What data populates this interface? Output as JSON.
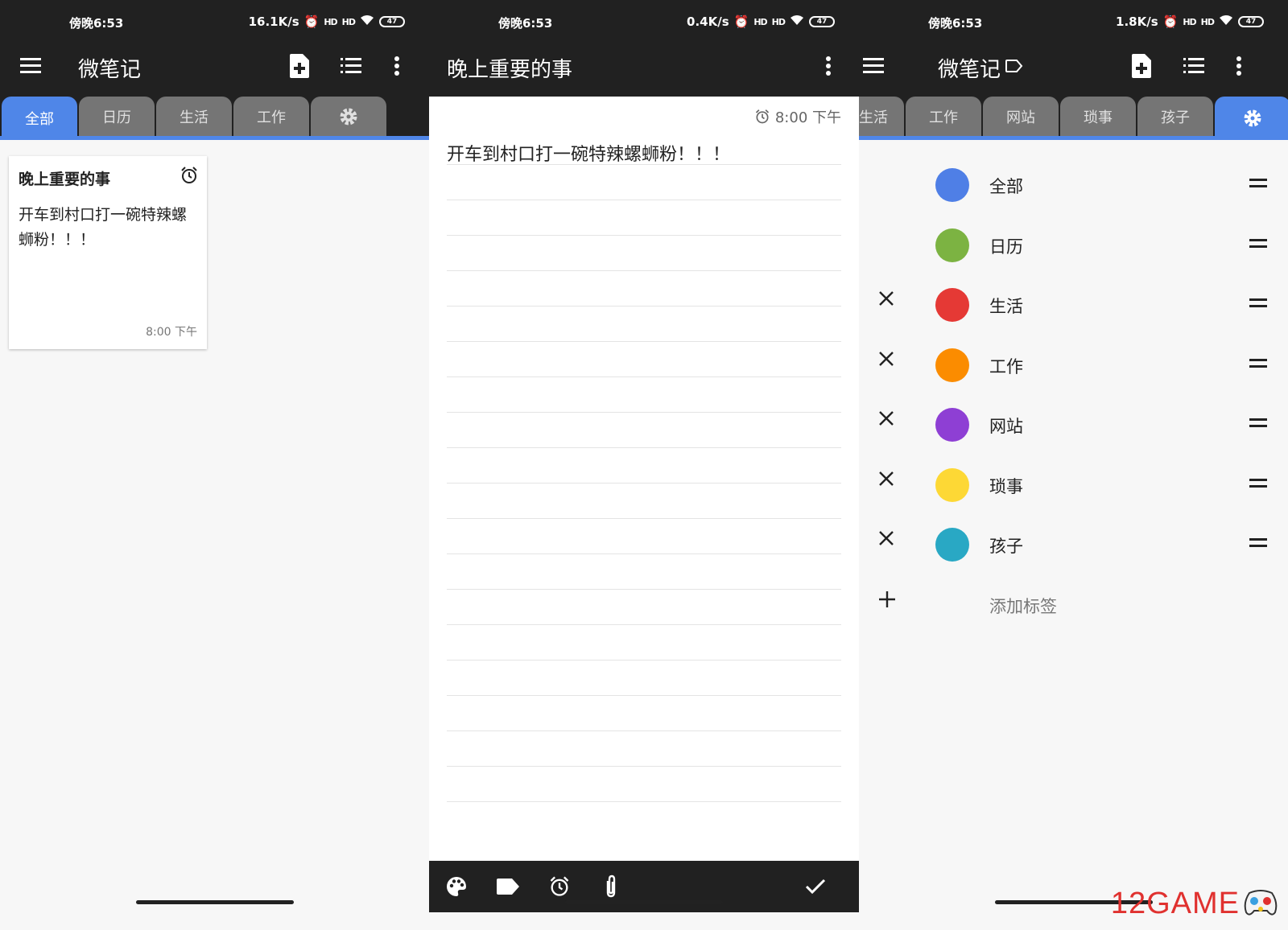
{
  "screens": [
    {
      "status": {
        "time": "傍晚6:53",
        "speed": "16.1K/s",
        "signal": "HD",
        "battery": "47"
      },
      "appbar": {
        "title": "微笔记"
      },
      "tabs": [
        "全部",
        "日历",
        "生活",
        "工作"
      ],
      "active_tab": "全部",
      "note_card": {
        "title": "晚上重要的事",
        "body": "开车到村口打一碗特辣螺蛳粉！！！",
        "time": "8:00 下午"
      }
    },
    {
      "status": {
        "time": "傍晚6:53",
        "speed": "0.4K/s",
        "signal": "HD",
        "battery": "47"
      },
      "appbar": {
        "title": "晚上重要的事"
      },
      "editor": {
        "reminder_time": "8:00 下午",
        "body": "开车到村口打一碗特辣螺蛳粉！！！"
      }
    },
    {
      "status": {
        "time": "傍晚6:53",
        "speed": "1.8K/s",
        "signal": "HD",
        "battery": "47"
      },
      "appbar": {
        "title": "微笔记"
      },
      "tabs": [
        "生活",
        "工作",
        "网站",
        "琐事",
        "孩子"
      ],
      "labels": [
        {
          "name": "全部",
          "color": "#4f7fe6",
          "removable": false
        },
        {
          "name": "日历",
          "color": "#7cb342",
          "removable": false
        },
        {
          "name": "生活",
          "color": "#e53935",
          "removable": true
        },
        {
          "name": "工作",
          "color": "#fb8c00",
          "removable": true
        },
        {
          "name": "网站",
          "color": "#8e3fd4",
          "removable": true
        },
        {
          "name": "琐事",
          "color": "#fdd835",
          "removable": true
        },
        {
          "name": "孩子",
          "color": "#29a8c4",
          "removable": true
        }
      ],
      "add_label": "添加标签"
    }
  ],
  "watermark": "12GAME",
  "colors": {
    "accent": "#4f86e8",
    "bar": "#212121",
    "tab_inactive": "#757575"
  }
}
